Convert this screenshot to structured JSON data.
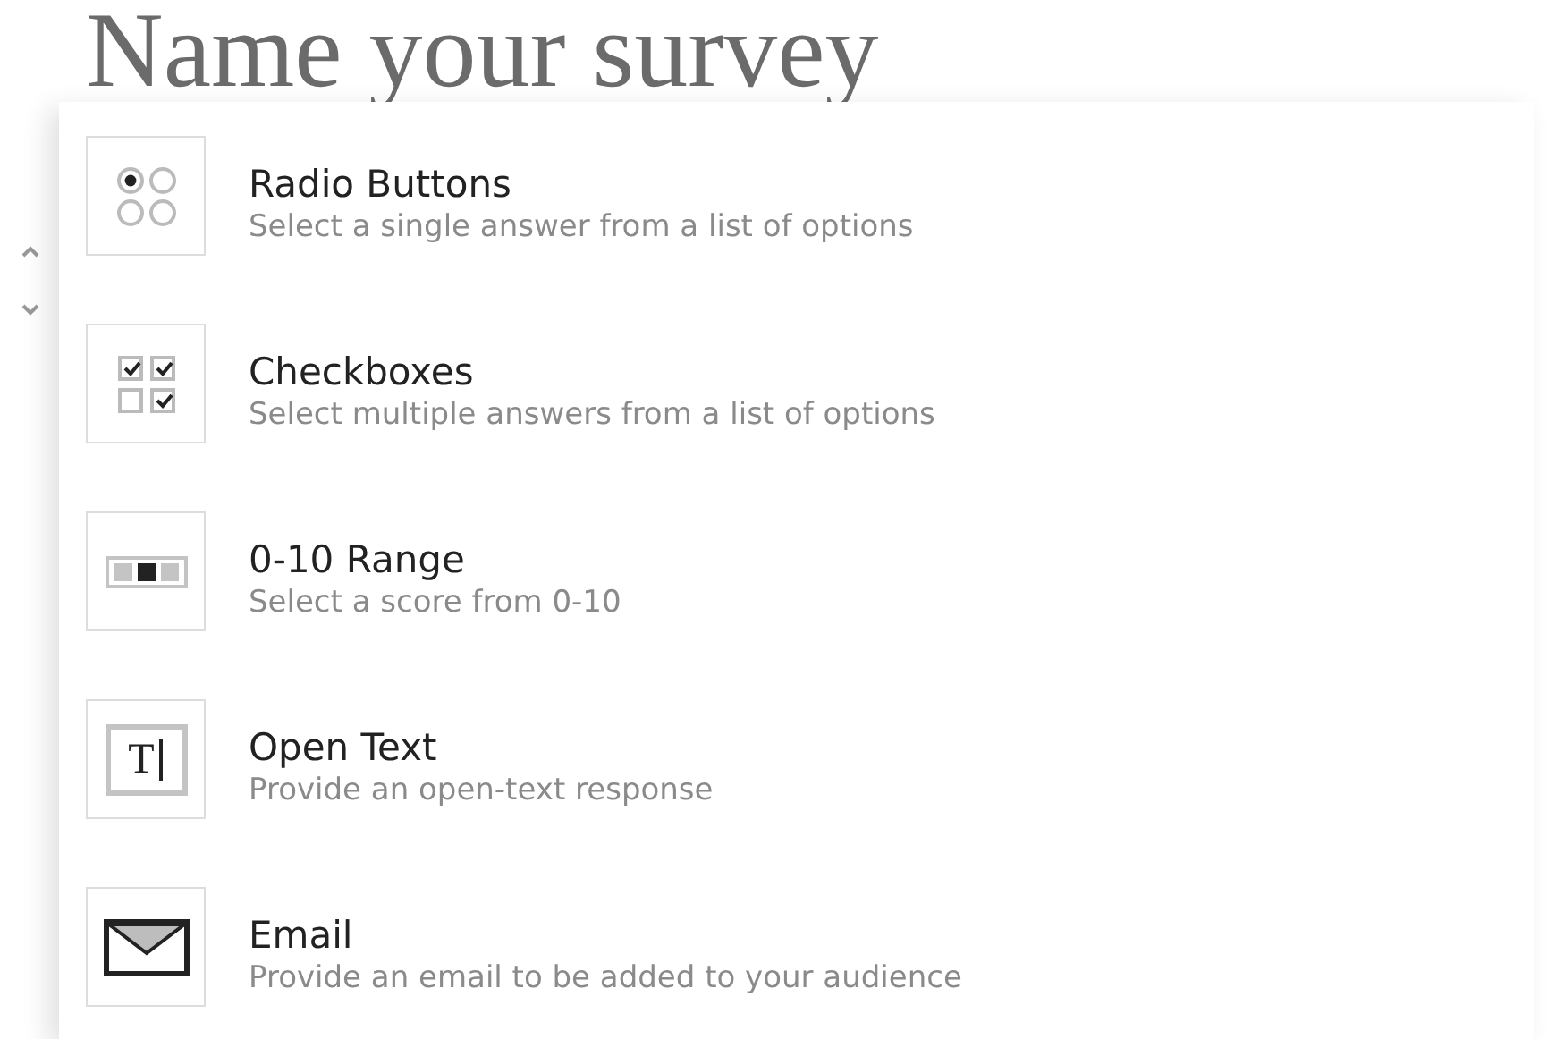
{
  "page_title": "Name your survey",
  "question_types": [
    {
      "kind": "radio",
      "title": "Radio Buttons",
      "description": "Select a single answer from a list of options"
    },
    {
      "kind": "checkbox",
      "title": "Checkboxes",
      "description": "Select multiple answers from a list of options"
    },
    {
      "kind": "range",
      "title": "0-10 Range",
      "description": "Select a score from 0-10"
    },
    {
      "kind": "text",
      "title": "Open Text",
      "description": "Provide an open-text response",
      "icon_glyph": "T"
    },
    {
      "kind": "email",
      "title": "Email",
      "description": "Provide an email to be added to your audience"
    }
  ]
}
